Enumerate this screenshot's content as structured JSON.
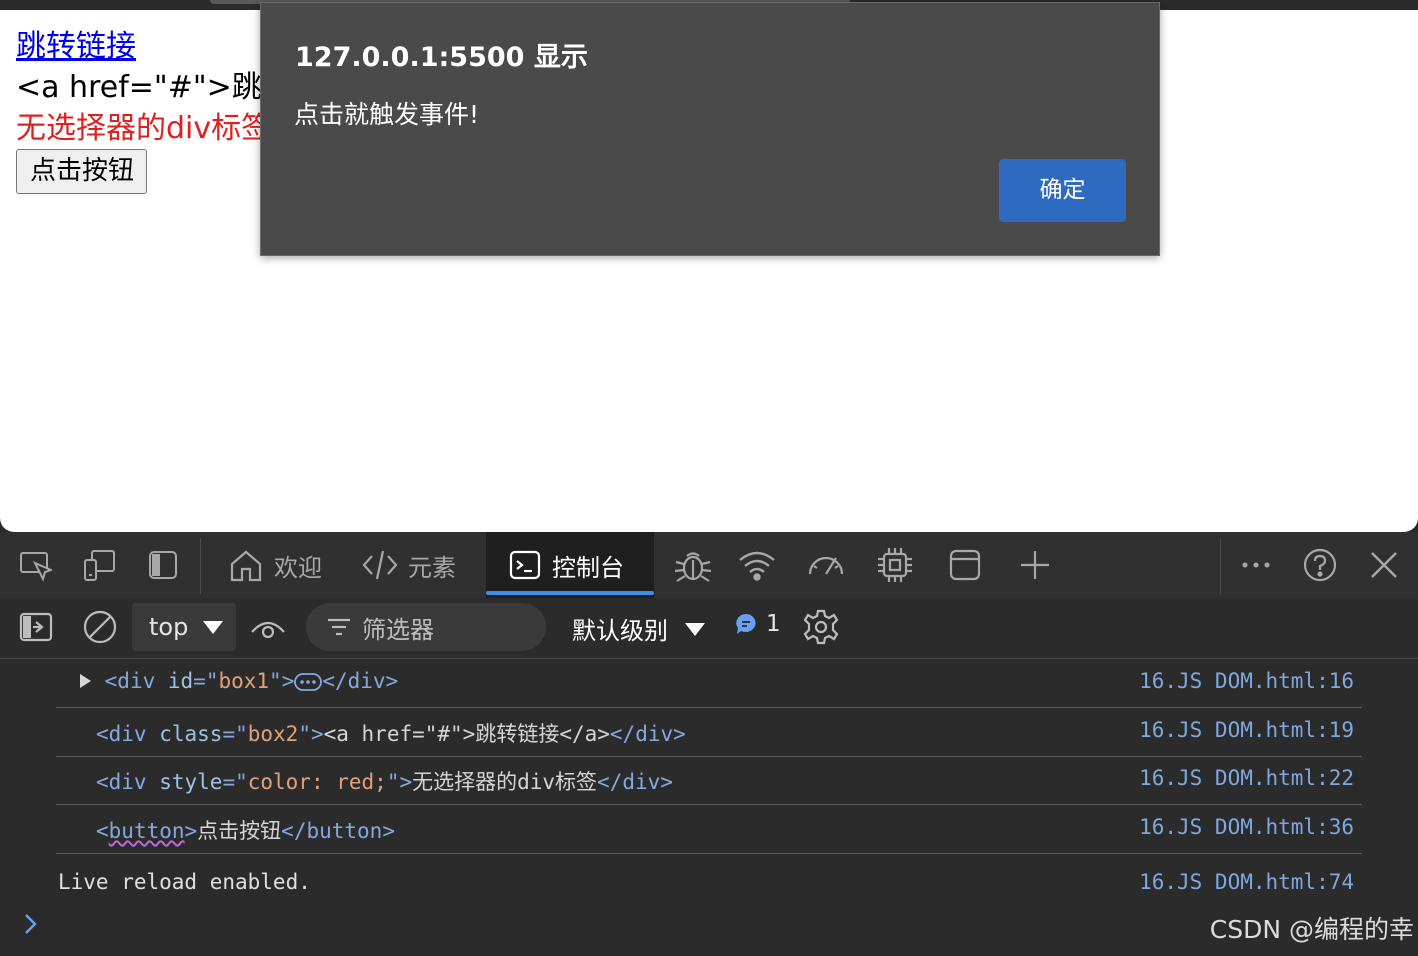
{
  "page": {
    "link_text": "跳转链接",
    "escaped_html_line": "<a href=\"#\">跳转",
    "red_div_text": "无选择器的div标签",
    "button_label": "点击按钮"
  },
  "dialog": {
    "title": "127.0.0.1:5500 显示",
    "message": "点击就触发事件!",
    "ok_label": "确定"
  },
  "devtools": {
    "tabs": [
      {
        "icon": "home-icon",
        "label": "欢迎"
      },
      {
        "icon": "elements-icon",
        "label": "元素"
      },
      {
        "icon": "console-icon",
        "label": "控制台",
        "active": true
      }
    ],
    "context_select": "top",
    "filter_placeholder": "筛选器",
    "level_select": "默认级别",
    "message_count": "1",
    "console_rows": [
      {
        "parts": [
          "<div ",
          "id",
          "=\"",
          "box1",
          "\">",
          "",
          "</div>"
        ],
        "source": "16.JS DOM.html:16"
      },
      {
        "parts": [
          "<div ",
          "class",
          "=\"",
          "box2",
          "\">",
          "<a href=\"#\">跳转链接</a>",
          "</div>"
        ],
        "source": "16.JS DOM.html:19"
      },
      {
        "parts": [
          "<div ",
          "style",
          "=\"",
          "color: red;",
          "\">",
          "无选择器的div标签",
          "</div>"
        ],
        "source": "16.JS DOM.html:22"
      },
      {
        "parts": [
          "<",
          "button",
          ">",
          "点击按钮",
          "</button>"
        ],
        "source": "16.JS DOM.html:36"
      }
    ],
    "live_reload_text": "Live reload enabled.",
    "live_reload_source": "16.JS DOM.html:74"
  },
  "watermark": "CSDN @编程的幸",
  "colors": {
    "dialog_bg": "#4a4a4a",
    "ok_button": "#2e6bc0",
    "active_tab_underline": "#3f8fea",
    "link": "#0000ee",
    "red_text": "#e02020"
  }
}
